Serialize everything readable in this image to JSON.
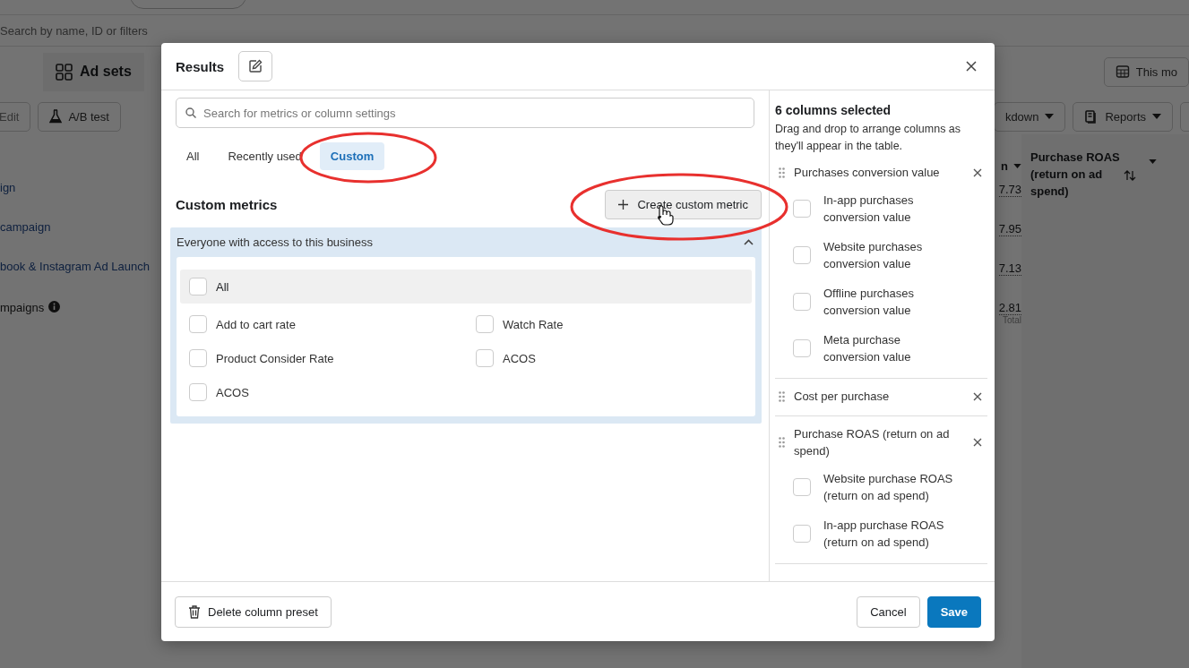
{
  "background": {
    "search_placeholder": "Search by name, ID or filters",
    "view_tab": "Ad sets",
    "toolbar_left": [
      "Edit",
      "A/B test"
    ],
    "date_button": "This mo",
    "toolbar_right": [
      "kdown",
      "Reports"
    ],
    "rows": [
      {
        "name": "ign",
        "info": false
      },
      {
        "name": "campaign",
        "info": false
      },
      {
        "name": "book & Instagram Ad Launch",
        "info": false
      },
      {
        "name": "mpaigns",
        "info": true
      }
    ],
    "columns": [
      {
        "header": "n",
        "sortable": false
      },
      {
        "header": "Purchase ROAS (return on ad spend)",
        "sortable": true
      }
    ],
    "values": [
      "7.73",
      "7.95",
      "7.13",
      "2.81"
    ],
    "total_label": "Total"
  },
  "dialog": {
    "title": "Results",
    "search": {
      "placeholder": "Search for metrics or column settings"
    },
    "tabs": [
      {
        "label": "All",
        "selected": false
      },
      {
        "label": "Recently used",
        "selected": false
      },
      {
        "label": "Custom",
        "selected": true
      }
    ],
    "section_title": "Custom metrics",
    "create_button": "Create custom metric",
    "group": {
      "title": "Everyone with access to this business",
      "expanded": true,
      "options": [
        {
          "kind": "all",
          "label": "All",
          "checked": false
        },
        {
          "kind": "metric",
          "label": "Add to cart rate",
          "checked": false
        },
        {
          "kind": "metric",
          "label": "Watch Rate",
          "checked": false
        },
        {
          "kind": "metric",
          "label": "Product Consider Rate",
          "checked": false
        },
        {
          "kind": "metric",
          "label": "ACOS",
          "checked": false
        },
        {
          "kind": "metric",
          "label": "ACOS",
          "checked": false
        }
      ]
    },
    "selected_panel": {
      "title": "6 columns selected",
      "hint": "Drag and drop to arrange columns as they'll appear in the table.",
      "columns": [
        {
          "label": "Purchases conversion value",
          "children": [
            {
              "label": "In-app purchases conversion value",
              "checked": false
            },
            {
              "label": "Website purchases conversion value",
              "checked": false
            },
            {
              "label": "Offline purchases conversion value",
              "checked": false
            },
            {
              "label": "Meta purchase conversion value",
              "checked": false
            }
          ]
        },
        {
          "label": "Cost per purchase"
        },
        {
          "label": "Purchase ROAS (return on ad spend)",
          "children": [
            {
              "label": "Website purchase ROAS (return on ad spend)",
              "checked": false
            },
            {
              "label": "In-app purchase ROAS (return on ad spend)",
              "checked": false
            }
          ]
        }
      ]
    },
    "footer": {
      "delete_button": "Delete column preset",
      "cancel_button": "Cancel",
      "save_button": "Save"
    }
  }
}
